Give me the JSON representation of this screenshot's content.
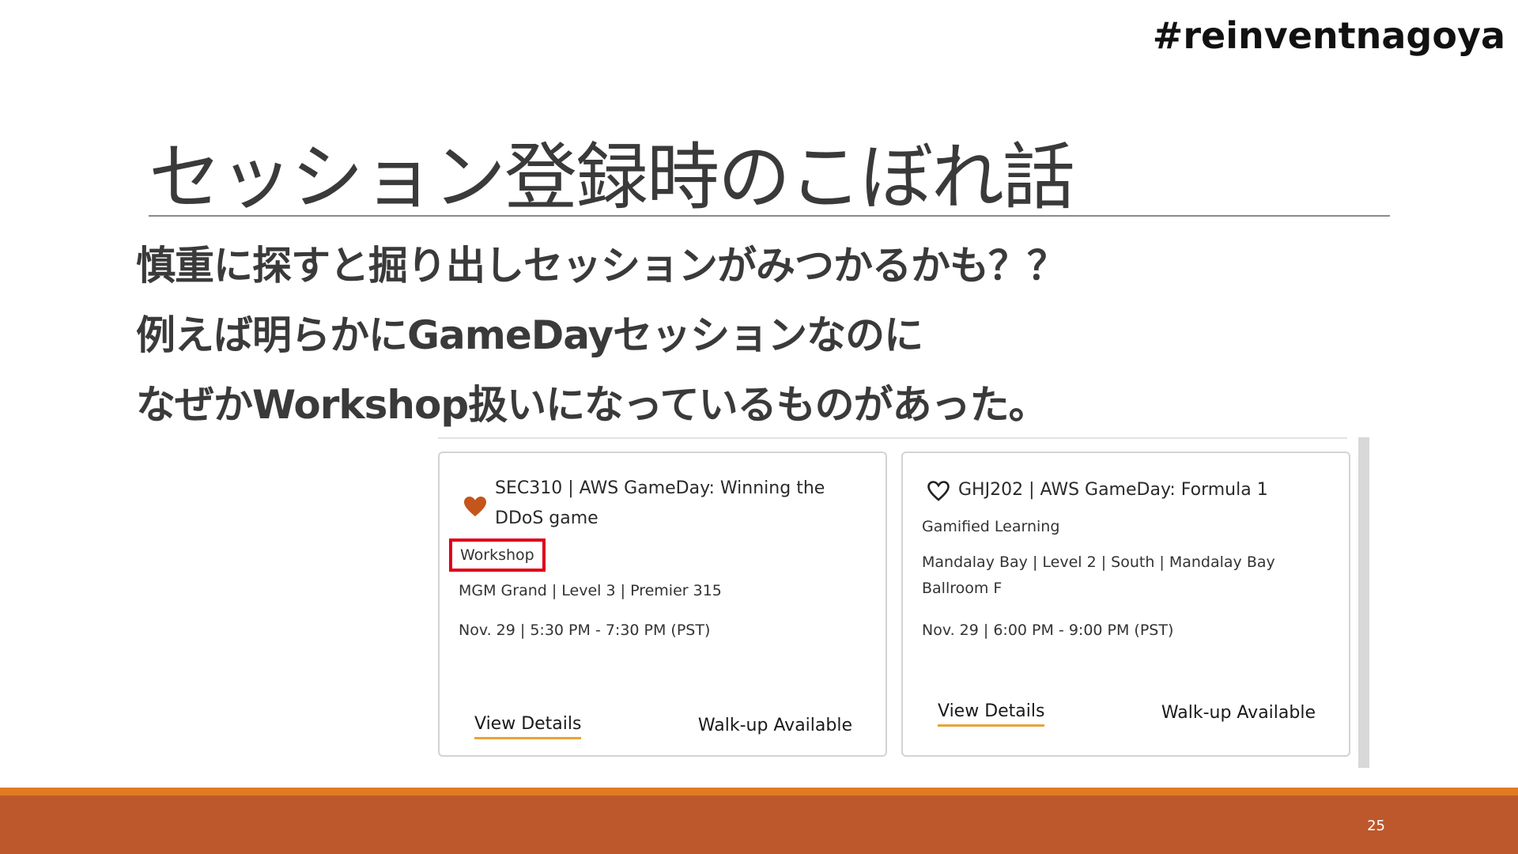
{
  "hashtag": "#reinventnagoya",
  "title": "セッション登録時のこぼれ話",
  "body": {
    "line1": "慎重に探すと掘り出しセッションがみつかるかも？？",
    "line2": "例えば明らかにGameDayセッションなのに",
    "line3": "なぜかWorkshop扱いになっているものがあった。"
  },
  "cards": [
    {
      "favorited": true,
      "title": "SEC310 | AWS GameDay: Winning the DDoS game",
      "type": "Workshop",
      "type_highlighted": true,
      "location": "MGM Grand | Level 3 | Premier 315",
      "datetime": "Nov. 29 | 5:30 PM - 7:30 PM (PST)",
      "view_details_label": "View Details",
      "availability": "Walk-up Available"
    },
    {
      "favorited": false,
      "title": "GHJ202 | AWS GameDay: Formula 1",
      "type": "Gamified Learning",
      "type_highlighted": false,
      "location": "Mandalay Bay | Level 2 | South | Mandalay Bay Ballroom F",
      "datetime": "Nov. 29 | 6:00 PM - 9:00 PM (PST)",
      "view_details_label": "View Details",
      "availability": "Walk-up Available"
    }
  ],
  "footer": {
    "page_number": "25"
  },
  "colors": {
    "footer_bar": "#bd582c",
    "footer_accent": "#e07b22",
    "heart_filled": "#c4551b",
    "highlight_box": "#e0001a",
    "link_underline": "#e8a33a"
  }
}
